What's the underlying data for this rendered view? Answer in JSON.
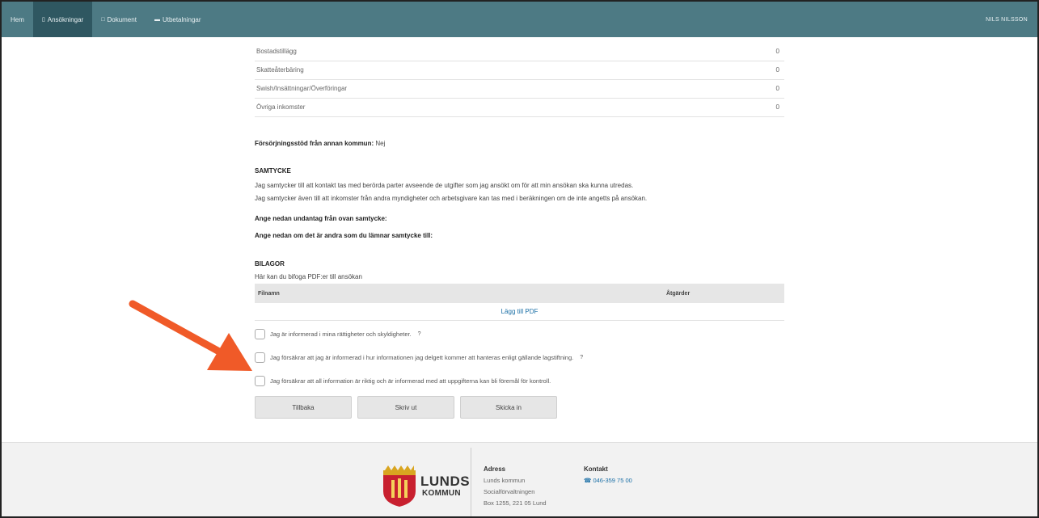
{
  "nav": {
    "items": [
      {
        "label": "Hem",
        "icon": ""
      },
      {
        "label": "Ansökningar",
        "icon": "document-icon"
      },
      {
        "label": "Dokument",
        "icon": "file-icon"
      },
      {
        "label": "Utbetalningar",
        "icon": "card-icon"
      }
    ],
    "user": "NILS NILSSON"
  },
  "income_rows": [
    {
      "label": "Bostadstillägg",
      "value": "0"
    },
    {
      "label": "Skatteåterbäring",
      "value": "0"
    },
    {
      "label": "Swish/Insättningar/Överföringar",
      "value": "0"
    },
    {
      "label": "Övriga inkomster",
      "value": "0"
    }
  ],
  "support": {
    "label": "Försörjningsstöd från annan kommun:",
    "value": "Nej"
  },
  "consent": {
    "heading": "SAMTYCKE",
    "text1": "Jag samtycker till att kontakt tas med berörda parter avseende de utgifter som jag ansökt om för att min ansökan ska kunna utredas.",
    "text2": "Jag samtycker även till att inkomster från andra myndigheter och arbetsgivare kan tas med i beräkningen om de inte angetts på ansökan.",
    "exceptions": "Ange nedan undantag från ovan samtycke:",
    "others": "Ange nedan om det är andra som du lämnar samtycke till:"
  },
  "attachments": {
    "heading": "BILAGOR",
    "subtitle": "Här kan du bifoga PDF:er till ansökan",
    "col_file": "Filnamn",
    "col_actions": "Åtgärder",
    "add_label": "Lägg till PDF"
  },
  "checks": [
    {
      "label": "Jag är informerad i mina rättigheter och skyldigheter.",
      "help": "?"
    },
    {
      "label": "Jag försäkrar att jag är informerad i hur informationen jag delgett kommer att hanteras enligt gällande lagstiftning.",
      "help": "?"
    },
    {
      "label": "Jag försäkrar att all information är riktig och är informerad med att uppgifterna kan bli föremål för kontroll.",
      "help": ""
    }
  ],
  "buttons": {
    "back": "Tillbaka",
    "print": "Skriv ut",
    "send": "Skicka in"
  },
  "footer": {
    "logo_line1": "LUNDS",
    "logo_line2": "KOMMUN",
    "address_title": "Adress",
    "address_lines": [
      "Lunds kommun",
      "Socialförvaltningen",
      "Box 1255, 221 05 Lund"
    ],
    "contact_title": "Kontakt",
    "phone": "046-359 75 00"
  },
  "colors": {
    "nav": "#4d7a84",
    "nav_active": "#2f5761",
    "arrow": "#f05a28",
    "link": "#1a6fa6"
  }
}
